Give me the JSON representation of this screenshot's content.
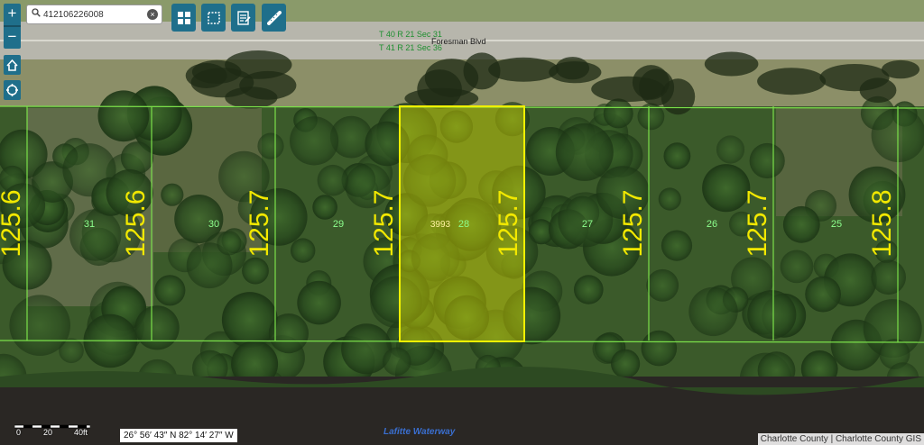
{
  "search": {
    "value": "412106226008"
  },
  "toolbar": {
    "zoom_in": "+",
    "zoom_out": "−",
    "tools": [
      "layers-icon",
      "select-icon",
      "report-icon",
      "measure-icon"
    ]
  },
  "map": {
    "road_name": "Foresman Blvd",
    "section_label_1": "T 40 R 21 Sec 31",
    "section_label_2": "T 41 R 21 Sec 36",
    "waterway_name": "Lafitte Waterway",
    "lots": [
      {
        "number": "31",
        "depth": "125.6"
      },
      {
        "number": "30",
        "depth": "125.6"
      },
      {
        "number": "29",
        "depth": "125.7"
      },
      {
        "number": "28",
        "depth": "125.7",
        "address": "3993",
        "selected": true
      },
      {
        "number": "27",
        "depth": "125.7"
      },
      {
        "number": "26",
        "depth": "125.7"
      },
      {
        "number": "25",
        "depth": "125.7"
      },
      {
        "number": "",
        "depth": "125.8"
      }
    ],
    "left_depth": "125.6",
    "colors": {
      "parcel_line": "#7be04a",
      "selected_fill": "#e6e600",
      "depth_text": "#f2e800",
      "lot_number": "#8dff8d"
    }
  },
  "scale_bar": {
    "ticks": [
      "0",
      "20",
      "40ft"
    ]
  },
  "coordinates": "26° 56′ 43″ N 82° 14′ 27″ W",
  "attribution": "Charlotte County | Charlotte County GIS"
}
